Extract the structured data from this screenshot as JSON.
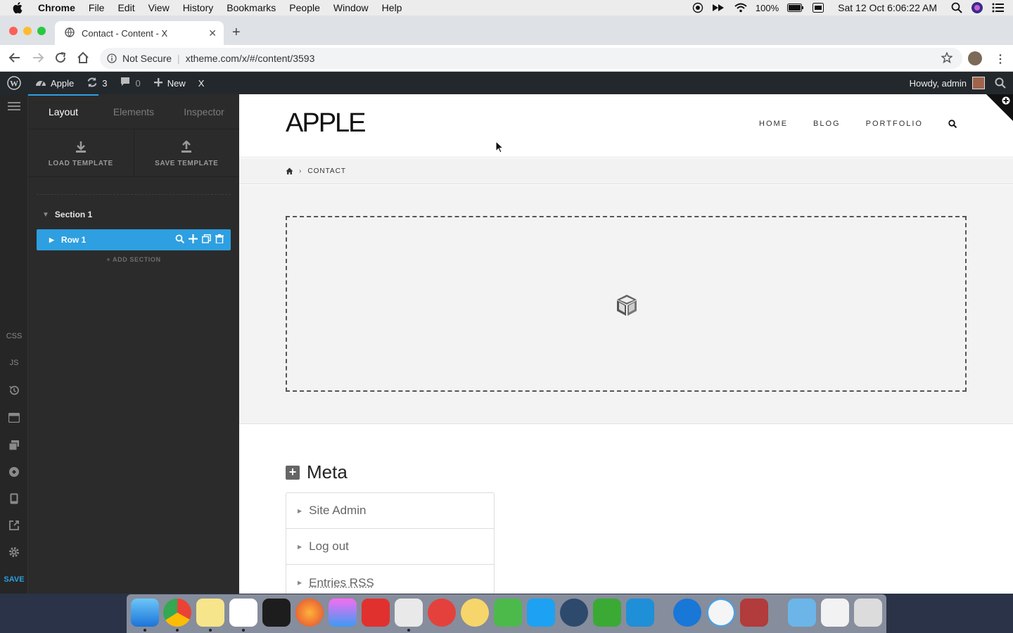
{
  "menubar": {
    "app": "Chrome",
    "items": [
      "File",
      "Edit",
      "View",
      "History",
      "Bookmarks",
      "People",
      "Window",
      "Help"
    ],
    "battery": "100%",
    "clock": "Sat 12 Oct  6:06:22 AM"
  },
  "browser": {
    "tab_title": "Contact - Content - X",
    "not_secure": "Not Secure",
    "url": "xtheme.com/x/#/content/3593"
  },
  "wpbar": {
    "site": "Apple",
    "updates": "3",
    "comments": "0",
    "new": "New",
    "x": "X",
    "howdy": "Howdy, admin"
  },
  "rail": {
    "css": "CSS",
    "js": "JS",
    "save": "SAVE"
  },
  "panel": {
    "tabs": [
      "Layout",
      "Elements",
      "Inspector"
    ],
    "load_template": "LOAD TEMPLATE",
    "save_template": "SAVE TEMPLATE",
    "section": "Section 1",
    "row": "Row 1",
    "add_section": "+ ADD SECTION"
  },
  "site": {
    "logo": "APPLE",
    "nav": [
      "HOME",
      "BLOG",
      "PORTFOLIO"
    ],
    "breadcrumb": "CONTACT",
    "meta_title": "Meta",
    "meta_items": [
      "Site Admin",
      "Log out",
      "Entries RSS"
    ]
  },
  "colors": {
    "accent": "#2e9fe0",
    "wpbar": "#23282d",
    "panel": "#2b2b2b"
  }
}
